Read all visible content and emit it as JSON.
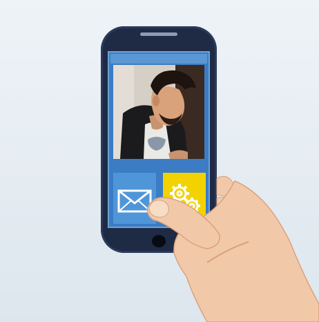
{
  "colors": {
    "background": "#e8eef3",
    "phone_body": "#1f2a44",
    "screen_blue": "#3b7cc4",
    "mail_tile": "#4f96d8",
    "settings_tile": "#f2d200",
    "skin": "#f2c9a8",
    "skin_shadow": "#d8a27e"
  },
  "icons": {
    "mail": "envelope-icon",
    "settings": "gears-icon"
  }
}
